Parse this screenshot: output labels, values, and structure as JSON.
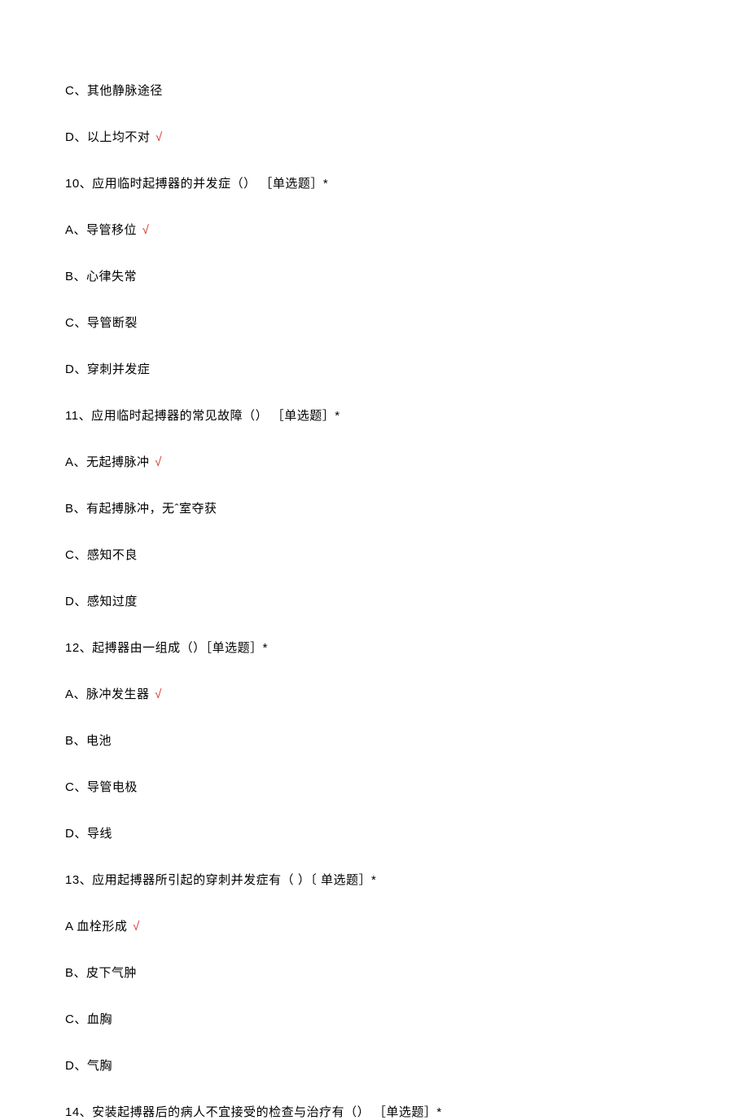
{
  "lines": [
    {
      "text": "C、其他静脉途径",
      "correct": false
    },
    {
      "text": "D、以上均不对",
      "correct": true
    },
    {
      "text": "10、应用临时起搏器的并发症（） ［单选题］*",
      "correct": false
    },
    {
      "text": "A、导管移位",
      "correct": true
    },
    {
      "text": "B、心律失常",
      "correct": false
    },
    {
      "text": "C、导管断裂",
      "correct": false
    },
    {
      "text": "D、穿刺并发症",
      "correct": false
    },
    {
      "text": "11、应用临时起搏器的常见故障（） ［单选题］*",
      "correct": false
    },
    {
      "text": "A、无起搏脉冲",
      "correct": true
    },
    {
      "text": "B、有起搏脉冲，无ˆ室夺获",
      "correct": false
    },
    {
      "text": "C、感知不良",
      "correct": false
    },
    {
      "text": "D、感知过度",
      "correct": false
    },
    {
      "text": "12、起搏器由一组成（）［单选题］*",
      "correct": false
    },
    {
      "text": "A、脉冲发生器",
      "correct": true
    },
    {
      "text": "B、电池",
      "correct": false
    },
    {
      "text": "C、导管电极",
      "correct": false
    },
    {
      "text": "D、导线",
      "correct": false
    },
    {
      "text": "13、应用起搏器所引起的穿刺并发症有（ ）〔 单选题］*",
      "correct": false
    },
    {
      "text": "A 血栓形成",
      "correct": true
    },
    {
      "text": "B、皮下气肿",
      "correct": false
    },
    {
      "text": "C、血胸",
      "correct": false
    },
    {
      "text": "D、气胸",
      "correct": false
    },
    {
      "text": "14、安装起搏器后的病人不宜接受的检查与治疗有（） ［单选题］*",
      "correct": false
    }
  ],
  "checkmark": "√"
}
